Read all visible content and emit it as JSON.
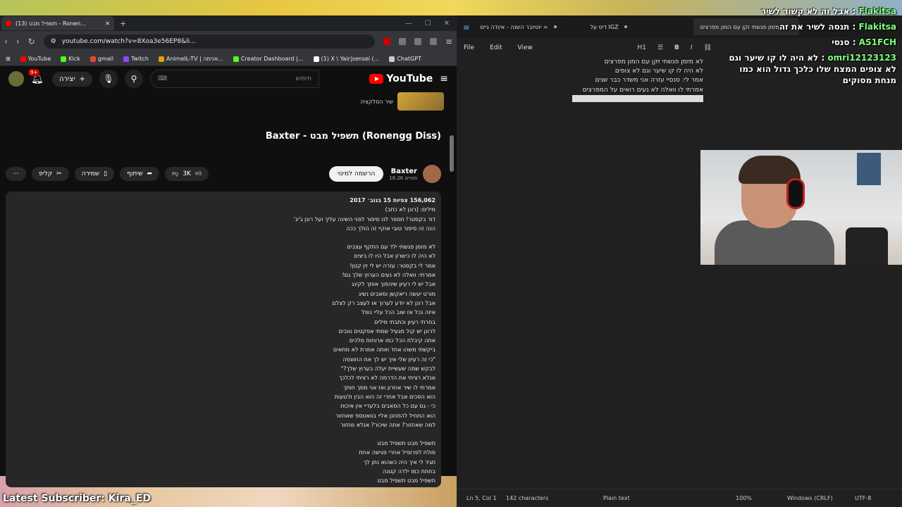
{
  "browser": {
    "tab_title": "(13) תשפיל מבט - Ronen…",
    "new_tab": "+",
    "url": "youtube.com/watch?v=8Xoa3e56EP8&li...",
    "bookmarks": [
      {
        "label": "YouTube",
        "color": "#ff0000"
      },
      {
        "label": "Kick",
        "color": "#53fc18"
      },
      {
        "label": "gmail",
        "color": "#ea4335"
      },
      {
        "label": "Twitch",
        "color": "#9146ff"
      },
      {
        "label": "AnimelL-TV | אנימה...",
        "color": "#e0a000"
      },
      {
        "label": "Creator Dashboard |...",
        "color": "#53fc18"
      },
      {
        "label": "(1) X \\ Yair|sensei (...",
        "color": "#ffffff"
      },
      {
        "label": "ChatGPT",
        "color": "#cccccc"
      }
    ]
  },
  "youtube": {
    "notifications": "9+",
    "create_label": "יצירה",
    "search_placeholder": "חיפוש",
    "logo_text": "YouTube",
    "playlist_item": "שיר הסלקציה",
    "video_title": "Baxter - תשפיל מבט (Ronengg Diss)",
    "channel_name": "Baxter",
    "channel_subs": "16.2K מנויים",
    "subscribe": "הרשמה למינוי",
    "likes": "3K",
    "share": "שיתוף",
    "save": "שמירה",
    "clip": "קליפ",
    "more": "⋯",
    "stats": "156,062 צפיות  15 בנוב׳ 2017",
    "description_lines": [
      "מילים: (רונן לא כתב)",
      "דוד בקסטר! תספר לנו סיפור לפני השינה עליך ועל רונן ג'יג'",
      "הנה זה סיפור טובי אוקיי זה הולך ככה",
      "",
      "לא מזמן פגשתי ילד עם התקף עצבים",
      "לא היה לו כישרון אבל היו לו ביצים",
      "אמר לי בקסטר: עזרה יש לי זין קטן!",
      "אמרתי: וואלה לא נעים הערוץ שלך גם!",
      "אבל יש לי רעיון שיהפוך אותך לקינג",
      "מורט יעשה ריאקשן ומאבים נשיג",
      "אבל רונן לא יודע לערוך או לעצב רק לצלם",
      "איזה נכל אז שוב הכל עליי נופל",
      "בחרתי רעיון וכתבתי מילים",
      "לרונן יש קול מגעיל שמתי אפקטים טובים",
      "אתה קיבלת הכל כמו ארוחות מלכים",
      "ביקשתי משהו אחד ואתה אמרת לא מתאים",
      "\"כי זה רעיון שלי איך יש לך את החוצפה",
      "לבקש שמה שעשיית יעלה בערוץ שלך?\"",
      "אנלא רציתי את הדרמה לא רציתי לכלכך",
      "אמרתי לו שיר אחרון ואז אני ממך חותך",
      "הוא הסכים אבל אחרי זה הוא הבין ת'טעות",
      "כי - גם עם כל הסאבים בלעדיי אין איכות",
      "הוא התחיל להתחנן אליי בוואטספ שאחזור",
      "למה שאחזור? אתה שיכור? אנלא מחזור",
      "",
      "תשפיל מבט תשפיל מבט",
      "סולח לפרופיל אחרי פגישה אחת",
      "תגיד לי איך היה כשהוא נתן לך",
      "בחתת כמו ילדה קטנה",
      "תשפיל מבט תשפיל מבט"
    ]
  },
  "notepad": {
    "tabs": [
      "יוטיובר השנה - אינדה גיים =",
      "דיס על IGZ",
      "לא מזמן פגשתי זקן עם המון מפרצים"
    ],
    "menu": [
      "File",
      "Edit",
      "View"
    ],
    "heading_tool": "H1",
    "lines": [
      "לא מזמן פגשתי זקן עם המון מפרצים",
      "לא היה לו קו שיער וגם לא צופים",
      "אמר לי: סנסיי עזרה אני משדר כבר שנים",
      "אמרתי לו וואלה לא נעים רואים על המפרצים"
    ],
    "status": {
      "position": "Ln 5, Col 1",
      "chars": "142 characters",
      "format": "Plain text",
      "zoom": "100%",
      "line_ending": "Windows (CRLF)",
      "encoding": "UTF-8"
    }
  },
  "chat": [
    {
      "user": "Flakitsa",
      "text": "אבל זה לא קשור לשיר"
    },
    {
      "user": "Flakitsa",
      "text": "תנסה לשיר את זה"
    },
    {
      "user": "AS1FCH",
      "text": "סנסי"
    },
    {
      "user": "omri12123123",
      "text": "לא היה לו קו שיער וגם לא צופים המצח שלו כלכך גדול הוא כמו מנחת מסוקים"
    }
  ],
  "overlay": {
    "latest_subscriber": "Latest Subscriber: Kira_ED"
  }
}
